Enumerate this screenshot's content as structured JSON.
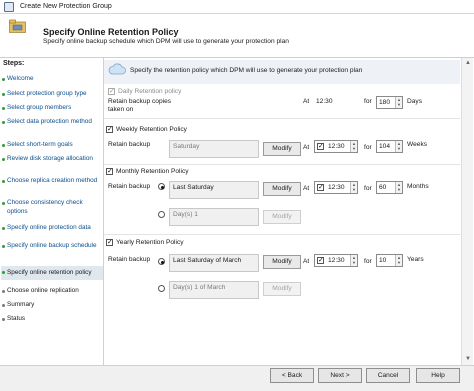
{
  "window": {
    "title": "Create New Protection Group"
  },
  "header": {
    "title": "Specify Online Retention Policy",
    "subtitle": "Specify online backup schedule which DPM will use to generate your protection plan"
  },
  "sidebar": {
    "title": "Steps:",
    "steps": [
      {
        "label": "Welcome"
      },
      {
        "label": "Select protection group type"
      },
      {
        "label": "Select group members"
      },
      {
        "label": "Select data protection method"
      },
      {
        "label": "Select short-term goals"
      },
      {
        "label": "Review disk storage allocation"
      },
      {
        "label": "Choose replica creation method"
      },
      {
        "label": "Choose consistency check options"
      },
      {
        "label": "Specify online protection data"
      },
      {
        "label": "Specify online backup schedule"
      },
      {
        "label": "Specify online retention policy"
      },
      {
        "label": "Choose online replication"
      },
      {
        "label": "Summary"
      },
      {
        "label": "Status"
      }
    ]
  },
  "banner": {
    "text": "Specify the retention policy which DPM will use to generate your protection plan"
  },
  "daily": {
    "checkbox_label": "Daily Retention policy",
    "retain_label": "Retain backup copies taken on",
    "at_label": "At",
    "time": "12:30",
    "for_label": "for",
    "count": "180",
    "unit": "Days"
  },
  "weekly": {
    "checkbox_label": "Weekly Retention Policy",
    "retain_label": "Retain backup",
    "day": "Saturday",
    "modify": "Modify",
    "at_label": "At",
    "time": "12:30",
    "for_label": "for",
    "count": "104",
    "unit": "Weeks"
  },
  "monthly": {
    "checkbox_label": "Monthly Retention Policy",
    "retain_label": "Retain backup",
    "option1": "Last Saturday",
    "option2": "Day(s) 1",
    "modify": "Modify",
    "at_label": "At",
    "time": "12:30",
    "for_label": "for",
    "count": "60",
    "unit": "Months"
  },
  "yearly": {
    "checkbox_label": "Yearly Retention Policy",
    "retain_label": "Retain backup",
    "option1": "Last Saturday of March",
    "option2": "Day(s) 1 of March",
    "modify": "Modify",
    "at_label": "At",
    "time": "12:30",
    "for_label": "for",
    "count": "10",
    "unit": "Years"
  },
  "footer": {
    "back": "< Back",
    "next": "Next >",
    "cancel": "Cancel",
    "help": "Help"
  }
}
